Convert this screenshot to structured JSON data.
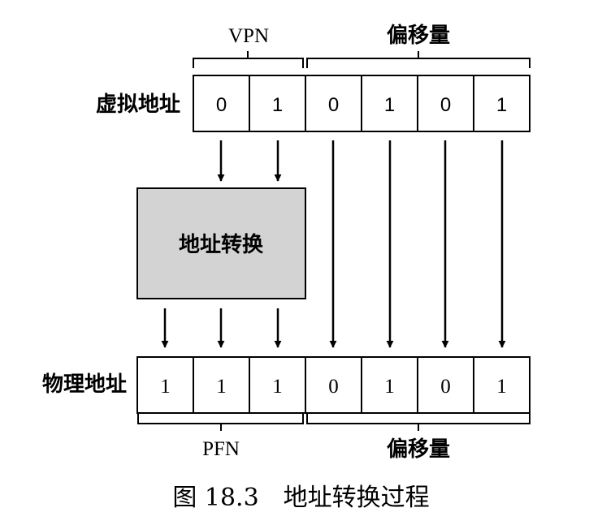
{
  "top_brackets": {
    "vpn": "VPN",
    "offset": "偏移量"
  },
  "bottom_brackets": {
    "pfn": "PFN",
    "offset": "偏移量"
  },
  "virtual_address": {
    "label": "虚拟地址",
    "bits": [
      "0",
      "1",
      "0",
      "1",
      "0",
      "1"
    ]
  },
  "translation_box": {
    "label": "地址转换",
    "fill": "#d3d3d3"
  },
  "physical_address": {
    "label": "物理地址",
    "bits": [
      "1",
      "1",
      "1",
      "0",
      "1",
      "0",
      "1"
    ]
  },
  "caption": "图 18.3　地址转换过程"
}
